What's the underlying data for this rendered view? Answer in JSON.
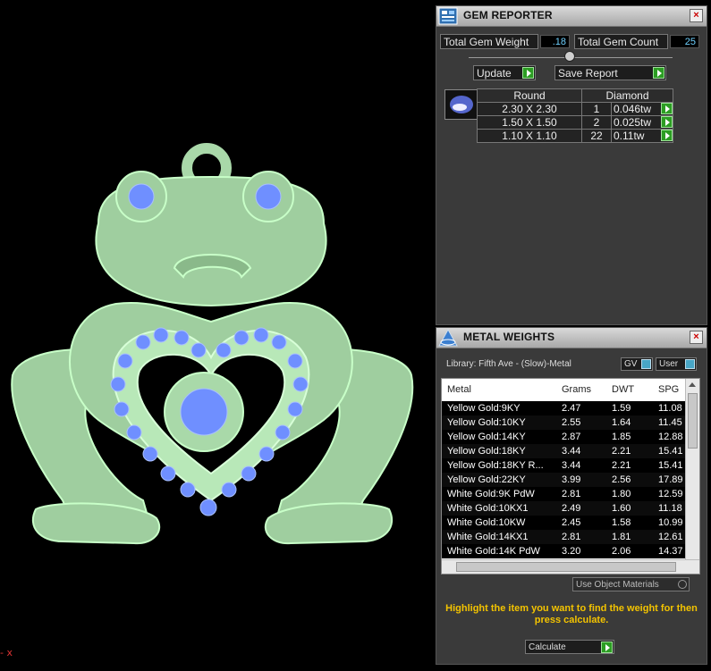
{
  "viewport": {
    "axis_label": "- x",
    "model_colors": {
      "body": "#9fce9f",
      "outline": "#c8ffc8",
      "gem": "#6f8fff"
    }
  },
  "gem_reporter": {
    "title": "GEM REPORTER",
    "close": "×",
    "total_weight_label": "Total Gem Weight",
    "total_weight_value": ".18",
    "total_count_label": "Total Gem Count",
    "total_count_value": "25",
    "update_label": "Update",
    "save_report_label": "Save Report",
    "shape": "Round",
    "stone": "Diamond",
    "rows": [
      {
        "size": "2.30 X 2.30",
        "count": "1",
        "weight": "0.046tw"
      },
      {
        "size": "1.50 X 1.50",
        "count": "2",
        "weight": "0.025tw"
      },
      {
        "size": "1.10 X 1.10",
        "count": "22",
        "weight": "0.11tw"
      }
    ]
  },
  "metal_weights": {
    "title": "METAL WEIGHTS",
    "close": "×",
    "library": "Library: Fifth Ave - (Slow)-Metal",
    "gv_label": "GV",
    "user_label": "User",
    "columns": [
      "Metal",
      "Grams",
      "DWT",
      "SPG"
    ],
    "rows": [
      {
        "metal": "Yellow Gold:9KY",
        "grams": "2.47",
        "dwt": "1.59",
        "spg": "11.08"
      },
      {
        "metal": "Yellow Gold:10KY",
        "grams": "2.55",
        "dwt": "1.64",
        "spg": "11.45"
      },
      {
        "metal": "Yellow Gold:14KY",
        "grams": "2.87",
        "dwt": "1.85",
        "spg": "12.88"
      },
      {
        "metal": "Yellow Gold:18KY",
        "grams": "3.44",
        "dwt": "2.21",
        "spg": "15.41"
      },
      {
        "metal": "Yellow Gold:18KY R...",
        "grams": "3.44",
        "dwt": "2.21",
        "spg": "15.41"
      },
      {
        "metal": "Yellow Gold:22KY",
        "grams": "3.99",
        "dwt": "2.56",
        "spg": "17.89"
      },
      {
        "metal": "White Gold:9K PdW",
        "grams": "2.81",
        "dwt": "1.80",
        "spg": "12.59"
      },
      {
        "metal": "White Gold:10KX1",
        "grams": "2.49",
        "dwt": "1.60",
        "spg": "11.18"
      },
      {
        "metal": "White Gold:10KW",
        "grams": "2.45",
        "dwt": "1.58",
        "spg": "10.99"
      },
      {
        "metal": "White Gold:14KX1",
        "grams": "2.81",
        "dwt": "1.81",
        "spg": "12.61"
      },
      {
        "metal": "White Gold:14K PdW",
        "grams": "3.20",
        "dwt": "2.06",
        "spg": "14.37"
      }
    ],
    "use_object_materials": "Use Object Materials",
    "instructions": "Highlight the item you want to find the weight for then press calculate.",
    "calculate_label": "Calculate"
  }
}
